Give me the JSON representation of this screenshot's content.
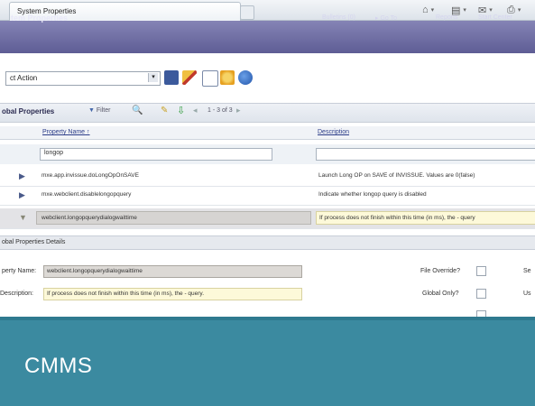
{
  "browser": {
    "tab_title": "System Properties"
  },
  "app_header": {
    "title": "tem Properties",
    "links": [
      "Bulletins (0)",
      "Go To",
      "Reports",
      "Start Center"
    ]
  },
  "action_bar": {
    "select_value": "ct Action"
  },
  "table": {
    "title": "obal Properties",
    "filter_label": "Filter",
    "pagination": "1 - 3 of 3",
    "columns": [
      "Property Name",
      "Description"
    ],
    "filter_value": "longop",
    "rows": [
      {
        "name": "mxe.app.invissue.doLongOpOnSAVE",
        "description": "Launch Long OP on SAVE of INVISSUE. Values are 0(false)"
      },
      {
        "name": "mxe.webclient.disablelongopquery",
        "description": "Indicate whether longop query is disabled"
      },
      {
        "name": "webclient.longopquerydialogwaittime",
        "description": "If process does not finish within this time (in ms), the - query"
      }
    ]
  },
  "details": {
    "title": "obal Properties Details",
    "property_name_label": "perty Name:",
    "property_name_value": "webclient.longopquerydialogwaittime",
    "description_label": "Description:",
    "description_value": "If process does not finish within this time (in ms), the - query.",
    "file_override_label": "File Override?",
    "global_only_label": "Global Only?",
    "right_label_1": "Se",
    "right_label_2": "Us"
  },
  "overlay": {
    "text": "CMMS"
  }
}
